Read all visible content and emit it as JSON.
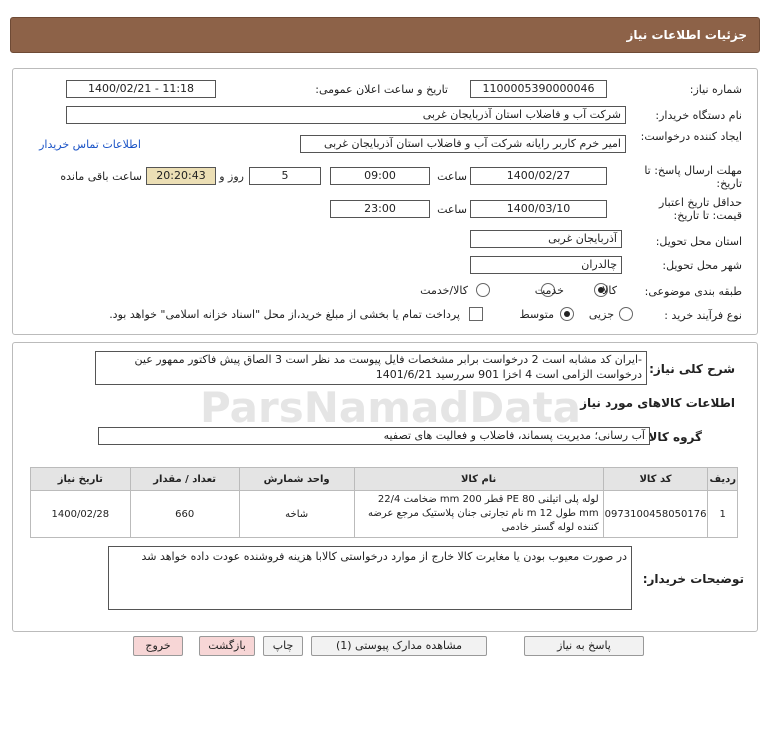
{
  "header": {
    "title": "جزئیات اطلاعات نیاز"
  },
  "form": {
    "need_number_label": "شماره نیاز:",
    "need_number": "1100005390000046",
    "announce_label": "تاریخ و ساعت اعلان عمومی:",
    "announce_value": "1400/02/21 - 11:18",
    "buyer_org_label": "نام دستگاه خریدار:",
    "buyer_org": "شرکت آب و فاضلاب استان آذربایجان غربی",
    "creator_label": "ایجاد کننده درخواست:",
    "creator": "امیر خرم کاربر رایانه شرکت آب و فاضلاب استان آذربایجان غربی",
    "contact_link": "اطلاعات تماس خریدار",
    "reply_deadline_label": "مهلت ارسال پاسخ: تا تاریخ:",
    "reply_date": "1400/02/27",
    "time_label": "ساعت",
    "reply_time": "09:00",
    "days_value": "5",
    "days_label": "روز و",
    "remaining_time": "20:20:43",
    "remaining_label": "ساعت باقی مانده",
    "price_validity_label": "حداقل تاریخ اعتبار قیمت: تا تاریخ:",
    "validity_date": "1400/03/10",
    "validity_time": "23:00",
    "province_label": "استان محل تحویل:",
    "province": "آذربایجان غربی",
    "city_label": "شهر محل تحویل:",
    "city": "چالدران",
    "category_label": "طبقه بندی موضوعی:",
    "category_options": [
      "کالا",
      "خدمت",
      "کالا/خدمت"
    ],
    "process_label": "نوع فرآیند خرید :",
    "process_options": [
      "جزیی",
      "متوسط"
    ],
    "payment_note": "پرداخت تمام یا بخشی از مبلغ خرید،از محل \"اسناد خزانه اسلامی\" خواهد بود."
  },
  "summary": {
    "label": "شرح کلی نیاز:",
    "text": "-ایران کد مشابه است 2 درخواست برابر مشخصات فایل پیوست مد نظر است 3 الصاق پیش فاکتور ممهور عین درخواست الزامی است 4 اخزا 901 سررسید 1401/6/21",
    "goods_info_title": "اطلاعات کالاهای مورد نیاز",
    "group_label": "گروه کالا:",
    "group_value": "آب رسانی؛ مدیریت پسماند، فاضلاب و فعالیت های تصفیه"
  },
  "table": {
    "headers": [
      "ردیف",
      "کد کالا",
      "نام کالا",
      "واحد شمارش",
      "تعداد / مقدار",
      "تاریخ نیاز"
    ],
    "rows": [
      {
        "row": "1",
        "code": "0973100458050176",
        "name": "لوله پلی اتیلنی PE 80 قطر 200 mm ضخامت 22/4 mm طول 12 m نام تجارتی جنان پلاستیک مرجع عرضه کننده لوله گستر خادمی",
        "unit": "شاخه",
        "qty": "660",
        "date": "1400/02/28"
      }
    ]
  },
  "notes": {
    "label": "توضیحات خریدار:",
    "text": "در صورت معیوب بودن یا مغایرت کالا خارج از موارد درخواستی کالابا هزینه فروشنده عودت داده خواهد شد"
  },
  "buttons": {
    "reply": "پاسخ به نیاز",
    "attachments": "مشاهده مدارک پیوستی (1)",
    "print": "چاپ",
    "back": "بازگشت",
    "exit": "خروج"
  },
  "watermark": {
    "text": "ParsNamadData"
  }
}
